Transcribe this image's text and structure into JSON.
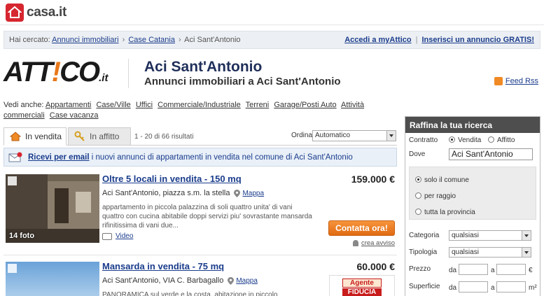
{
  "site": {
    "brand": "casa.it"
  },
  "breadcrumb": {
    "prefix": "Hai cercato:",
    "items": [
      "Annunci immobiliari",
      "Case Catania"
    ],
    "current": "Aci Sant'Antonio",
    "sep": "›"
  },
  "top_links": {
    "myattico": "Accedi a myAttico",
    "insert": "Inserisci un annuncio GRATIS!"
  },
  "header": {
    "logo_text": "ATT",
    "logo_text_2": "CO",
    "logo_suffix": ".it",
    "title": "Aci Sant'Antonio",
    "subtitle": "Annunci immobiliari a Aci Sant'Antonio",
    "feed": "Feed Rss"
  },
  "vedi_anche": {
    "label": "Vedi anche:",
    "links": [
      "Appartamenti",
      "Case/Ville",
      "Uffici",
      "Commerciale/Industriale",
      "Terreni",
      "Garage/Posti Auto",
      "Attività commerciali",
      "Case vacanza"
    ]
  },
  "tabs": {
    "sale": "In vendita",
    "rent": "In affitto"
  },
  "results": {
    "count": "1 - 20 di 66 risultati",
    "order_label": "Ordina",
    "order_value": "Automatico"
  },
  "alert": {
    "bold": "Ricevi per email",
    "rest": " i nuovi annunci di appartamenti in vendita nel comune di Aci Sant'Antonio"
  },
  "listings": [
    {
      "title": "Oltre 5 locali in vendita - 150 mq",
      "price": "159.000 €",
      "address": "Aci Sant'Antonio, piazza s.m. la stella",
      "map": "Mappa",
      "description": "appartamento in piccola palazzina di soli quattro unita' di vani quattro con cucina abitabile doppi servizi piu' sovrastante mansarda rifinitissima di vani due...",
      "photos": "14 foto",
      "video": "Video",
      "contact": "Contatta ora!",
      "alert": "crea avviso"
    },
    {
      "title": "Mansarda in vendita - 75 mq",
      "price": "60.000 €",
      "address": "Aci Sant'Antonio, VIA C. Barbagallo",
      "map": "Mappa",
      "description": "PANORAMICA sul verde e la costa, abitazione in piccolo condominio,",
      "agent_line1": "Agente",
      "agent_line2": "FIDUCIA"
    }
  ],
  "sidebar": {
    "title": "Raffina la tua ricerca",
    "contratto_label": "Contratto",
    "contratto_options": [
      "Vendita",
      "Affitto"
    ],
    "dove_label": "Dove",
    "dove_value": "Aci Sant'Antonio",
    "scope_options": [
      "solo il comune",
      "per raggio",
      "tutta la provincia"
    ],
    "categoria_label": "Categoria",
    "categoria_value": "qualsiasi",
    "tipologia_label": "Tipologia",
    "tipologia_value": "qualsiasi",
    "prezzo_label": "Prezzo",
    "superficie_label": "Superficie",
    "da": "da",
    "a": "a",
    "euro": "€",
    "mq": "m²"
  }
}
